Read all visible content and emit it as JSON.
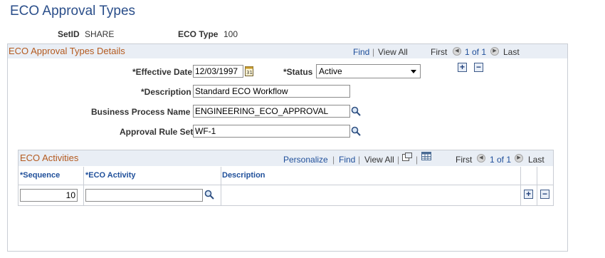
{
  "page": {
    "title": "ECO Approval Types"
  },
  "keys": {
    "setid_label": "SetID",
    "setid_value": "SHARE",
    "ecotype_label": "ECO Type",
    "ecotype_value": "100"
  },
  "details": {
    "section_title": "ECO Approval Types Details",
    "nav": {
      "find": "Find",
      "sep": "|",
      "view_all": "View All",
      "first": "First",
      "count": "1 of 1",
      "last": "Last"
    },
    "effective_date_label": "*Effective Date",
    "effective_date_value": "12/03/1997",
    "status_label": "*Status",
    "status_value": "Active",
    "description_label": "*Description",
    "description_value": "Standard ECO Workflow",
    "bp_label": "Business Process Name",
    "bp_value": "ENGINEERING_ECO_APPROVAL",
    "rule_label": "Approval Rule Set",
    "rule_value": "WF-1",
    "add_symbol": "+",
    "remove_symbol": "−"
  },
  "activities": {
    "title": "ECO Activities",
    "nav": {
      "personalize": "Personalize",
      "sep": "|",
      "find": "Find",
      "view_all": "View All",
      "first": "First",
      "count": "1 of 1",
      "last": "Last"
    },
    "columns": [
      "*Sequence",
      "*ECO Activity",
      "Description"
    ],
    "rows": [
      {
        "sequence": "10",
        "activity": "",
        "description": ""
      }
    ],
    "add_symbol": "+",
    "remove_symbol": "−"
  },
  "icons": {
    "calendar": "calendar-icon",
    "lookup": "magnifier-icon",
    "zoom": "grid-zoom-icon",
    "download": "spreadsheet-icon"
  },
  "colors": {
    "title": "#2a4e8a",
    "section_title": "#b45a1f",
    "link": "#1f4f9a",
    "header_bg": "#e9eef5"
  }
}
